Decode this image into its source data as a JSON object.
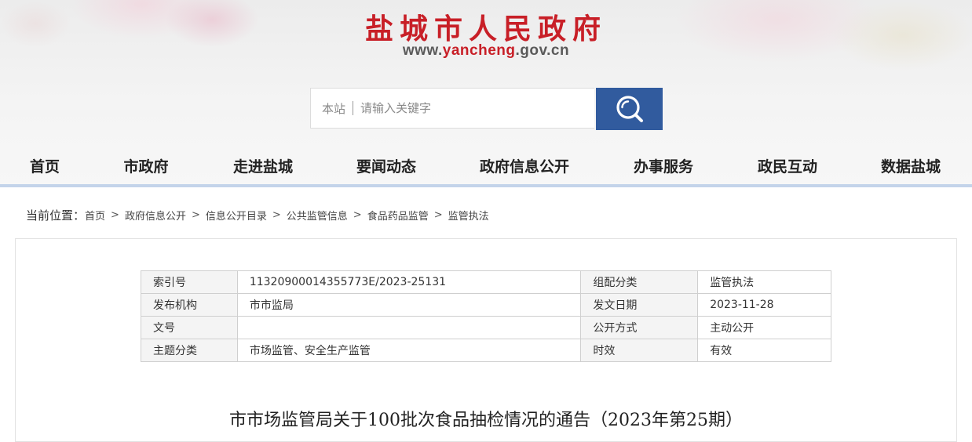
{
  "header": {
    "site_title": "盐城市人民政府",
    "url": {
      "prefix": "www.",
      "main": "yancheng",
      "suffix": ".gov.cn"
    },
    "accent_color": "#c81f27"
  },
  "search": {
    "scope_label": "本站",
    "placeholder": "请输入关键字",
    "button_icon": "search-icon",
    "button_color": "#315b9e"
  },
  "nav": {
    "items": [
      "首页",
      "市政府",
      "走进盐城",
      "要闻动态",
      "政府信息公开",
      "办事服务",
      "政民互动",
      "数据盐城"
    ]
  },
  "breadcrumb": {
    "label": "当前位置：",
    "items": [
      "首页",
      "政府信息公开",
      "信息公开目录",
      "公共监管信息",
      "食品药品监管",
      "监管执法"
    ],
    "separator": ">"
  },
  "meta_table": {
    "rows": [
      {
        "label1": "索引号",
        "value1": "11320900014355773E/2023-25131",
        "label2": "组配分类",
        "value2": "监管执法"
      },
      {
        "label1": "发布机构",
        "value1": "市市监局",
        "label2": "发文日期",
        "value2": "2023-11-28"
      },
      {
        "label1": "文号",
        "value1": "",
        "label2": "公开方式",
        "value2": "主动公开"
      },
      {
        "label1": "主题分类",
        "value1": "市场监管、安全生产监管",
        "label2": "时效",
        "value2": "有效"
      }
    ]
  },
  "document": {
    "title": "市市场监管局关于100批次食品抽检情况的通告（2023年第25期）"
  }
}
